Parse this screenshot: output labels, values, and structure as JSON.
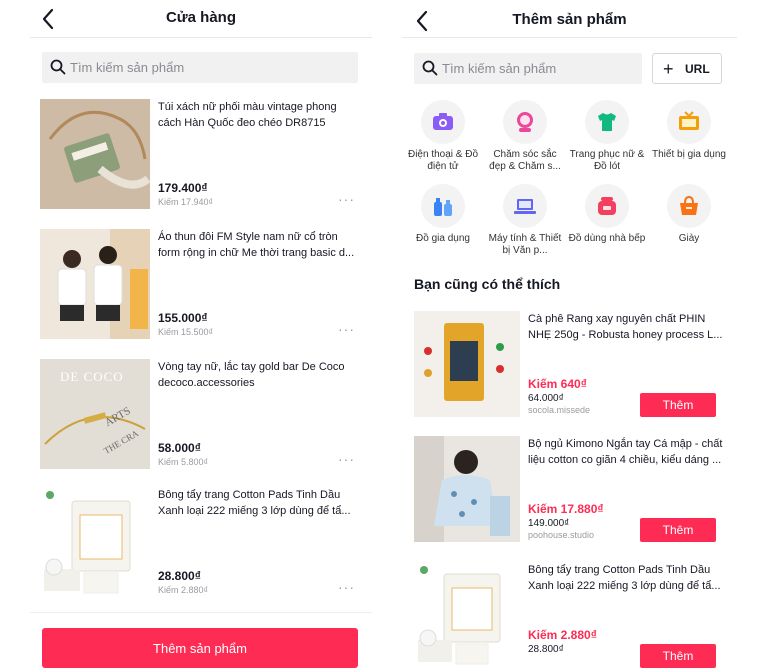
{
  "left": {
    "header": {
      "title": "Cửa hàng"
    },
    "search": {
      "placeholder": "Tìm kiếm sản phẩm"
    },
    "products": [
      {
        "name": "Túi xách nữ phối màu vintage phong cách Hàn Quốc đeo chéo DR8715",
        "price": "179.400₫",
        "earn": "Kiếm 17.940₫"
      },
      {
        "name": "Áo thun đôi FM Style nam nữ cổ tròn form rộng in chữ Me thời trang basic d...",
        "price": "155.000₫",
        "earn": "Kiếm 15.500₫"
      },
      {
        "name": "Vòng tay nữ, lắc tay gold bar De Coco decoco.accessories",
        "price": "58.000₫",
        "earn": "Kiếm 5.800₫",
        "thumb_text": [
          "DE COCO",
          "ARTS",
          "THE CRA"
        ]
      },
      {
        "name": "Bông tẩy trang Cotton Pads Tinh Dầu Xanh loại 222 miếng 3 lớp dùng để tẩ...",
        "price": "28.800₫",
        "earn": "Kiếm 2.880₫"
      }
    ],
    "more_label": "···",
    "add_button": "Thêm sản phẩm"
  },
  "right": {
    "header": {
      "title": "Thêm sản phẩm"
    },
    "search": {
      "placeholder": "Tìm kiếm sản phẩm"
    },
    "url_button": {
      "plus": "+",
      "label": "URL"
    },
    "categories": [
      {
        "label": "Điện thoại & Đồ điện tử",
        "icon": "camera-icon",
        "color": "#8b5cf6"
      },
      {
        "label": "Chăm sóc sắc đẹp & Chăm s...",
        "icon": "mirror-icon",
        "color": "#ec4899"
      },
      {
        "label": "Trang phục nữ & Đồ lót",
        "icon": "shirt-icon",
        "color": "#10b981"
      },
      {
        "label": "Thiết bị gia dụng",
        "icon": "tv-icon",
        "color": "#f59e0b"
      },
      {
        "label": "Đồ gia dụng",
        "icon": "bottles-icon",
        "color": "#3b82f6"
      },
      {
        "label": "Máy tính & Thiết bị Văn p...",
        "icon": "laptop-icon",
        "color": "#6366f1"
      },
      {
        "label": "Đồ dùng nhà bếp",
        "icon": "cooker-icon",
        "color": "#f43f5e"
      },
      {
        "label": "Giày",
        "icon": "bag-icon",
        "color": "#f97316"
      }
    ],
    "section_title": "Bạn cũng có thể thích",
    "recommendations": [
      {
        "name": "Cà phê Rang xay nguyên chất PHIN NHẸ 250g - Robusta honey process L...",
        "earn": "Kiếm 640₫",
        "price": "64.000₫",
        "shop": "socola.missede",
        "button": "Thêm"
      },
      {
        "name": "Bộ ngủ Kimono Ngắn tay Cá mập - chất liệu cotton co giãn 4 chiều, kiểu dáng ...",
        "earn": "Kiếm 17.880₫",
        "price": "149.000₫",
        "shop": "poohouse.studio",
        "button": "Thêm"
      },
      {
        "name": "Bông tẩy trang Cotton Pads Tinh Dầu Xanh loại 222 miếng 3 lớp dùng để tẩ...",
        "earn": "Kiếm 2.880₫",
        "price": "28.800₫",
        "shop": "",
        "button": "Thêm"
      }
    ]
  },
  "colors": {
    "accent": "#fe2c55",
    "text": "#161823",
    "muted": "#8a8b91",
    "search_bg": "#f1f1f2"
  }
}
